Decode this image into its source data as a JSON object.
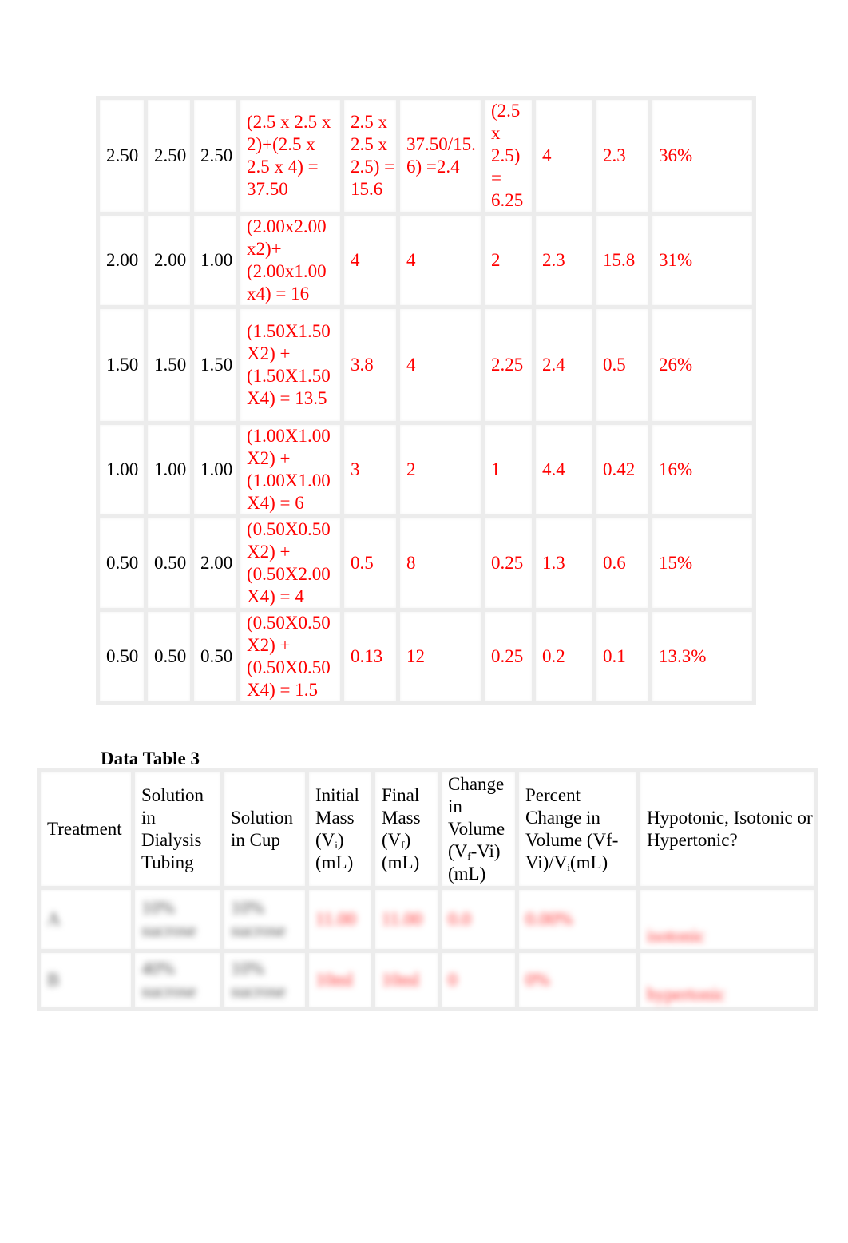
{
  "table_2": {
    "rows": [
      {
        "c1": "2.50",
        "c2": "2.50",
        "c3": "2.50",
        "surface_area": "(2.5 x 2.5 x 2)+(2.5 x 2.5 x 4) = 37.50",
        "volume": "2.5 x 2.5 x 2.5) = 15.6",
        "ratio": "37.50/15.6) =2.4",
        "c7": "(2.5 x 2.5) = 6.25",
        "c8": "4",
        "c9": "2.3",
        "c10": "36%"
      },
      {
        "c1": "2.00",
        "c2": "2.00",
        "c3": "1.00",
        "surface_area": "(2.00x2.00 x2)+ (2.00x1.00 x4) = 16",
        "volume": "4",
        "ratio": "4",
        "c7": "2",
        "c8": "2.3",
        "c9": "15.8",
        "c10": "31%"
      },
      {
        "c1": "1.50",
        "c2": "1.50",
        "c3": "1.50",
        "surface_area": "(1.50X1.50X2) + (1.50X1.50X4) = 13.5",
        "volume": "3.8",
        "ratio": "4",
        "c7": "2.25",
        "c8": "2.4",
        "c9": "0.5",
        "c10": "26%"
      },
      {
        "c1": "1.00",
        "c2": "1.00",
        "c3": "1.00",
        "surface_area": "(1.00X1.00X2) + (1.00X1.00X4) = 6",
        "volume": "3",
        "ratio": "2",
        "c7": "1",
        "c8": "4.4",
        "c9": "0.42",
        "c10": "16%"
      },
      {
        "c1": "0.50",
        "c2": "0.50",
        "c3": "2.00",
        "surface_area": "(0.50X0.50X2) + (0.50X2.00X4) = 4",
        "volume": "0.5",
        "ratio": "8",
        "c7": "0.25",
        "c8": "1.3",
        "c9": "0.6",
        "c10": "15%"
      },
      {
        "c1": "0.50",
        "c2": "0.50",
        "c3": "0.50",
        "surface_area": "(0.50X0.50X2) + (0.50X0.50X4) = 1.5",
        "volume": "0.13",
        "ratio": "12",
        "c7": "0.25",
        "c8": "0.2",
        "c9": "0.1",
        "c10": "13.3%"
      }
    ]
  },
  "table_3": {
    "title": "Data Table 3",
    "headers": {
      "treatment": "Treatment",
      "tubing": "Solution in Dialysis Tubing",
      "cup": "Solution in Cup",
      "initial_a": "Initial Mass (V",
      "initial_sub": "i",
      "initial_b": ") (mL)",
      "final_a": "Final Mass (V",
      "final_sub": "f",
      "final_b": ") (mL)",
      "change_a": "Change in Volume (V",
      "change_sub": "f",
      "change_b": "-Vi) (mL)",
      "percent_a": "Percent Change in Volume (Vf-Vi)/V",
      "percent_sub": "i",
      "percent_b": "(mL)",
      "tonicity": "Hypotonic, Isotonic or Hypertonic?"
    },
    "rows": [
      {
        "treatment": "A",
        "tubing": "10% sucrose",
        "cup": "10% sucrose",
        "initial": "11.00",
        "final": "11.00",
        "change": "0.0",
        "percent": "0.00%",
        "tonicity": "isotonic"
      },
      {
        "treatment": "B",
        "tubing": "40% sucrose",
        "cup": "10% sucrose",
        "initial": "10ml",
        "final": "10ml",
        "change": "0",
        "percent": "0%",
        "tonicity": "hypertonic"
      }
    ],
    "blurred": true
  },
  "colors": {
    "answer_text": "#ff0000",
    "grid": "#ececec"
  }
}
